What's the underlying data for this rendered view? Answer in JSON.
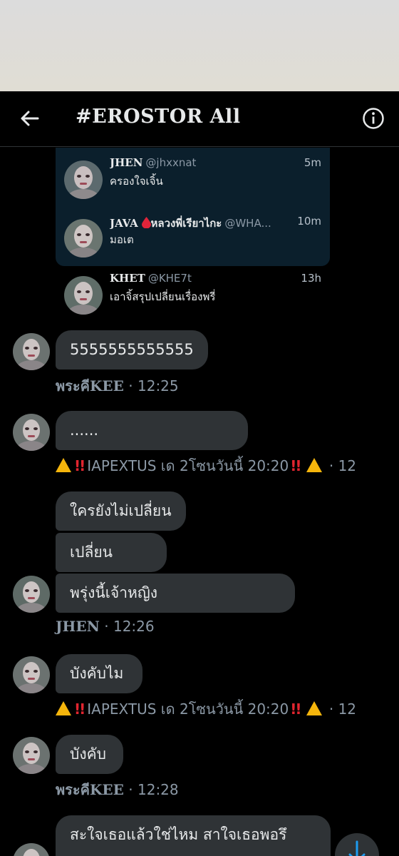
{
  "header": {
    "title": "#EROSTOR All",
    "back_icon": "back-arrow-icon",
    "info_icon": "info-icon"
  },
  "shared_tweets": [
    {
      "name": "JHEN",
      "handle": "@jhxxnat",
      "time": "5m",
      "text": "ครองใจเจิ้น"
    },
    {
      "name": "JAVA",
      "name_extra": "หลวงพี่เรียาไกะ",
      "handle": "@WHA...",
      "time": "10m",
      "text": "มอเต"
    },
    {
      "name": "KHET",
      "handle": "@KHE7t",
      "time": "13h",
      "text": "เอาจิ้สรุปเปลี่ยนเรื่องพรี่"
    }
  ],
  "messages": {
    "m1": "5555555555555",
    "meta1_name": "พระคีKEE",
    "meta1_time": " · 12:25",
    "m2": "......",
    "warn1_text": "IAPEXTUS เด 2โซนวันนี้ 20:20",
    "warn_sep": " · 12",
    "m3": "ใครยังไม่เปลี่ยน",
    "m4": "เปลี่ยน",
    "m5": "พรุ่งนี้เจ้าหญิง",
    "meta2_name": "JHEN",
    "meta2_time": " · 12:26",
    "m6": "บังคับไม",
    "warn2_text": "IAPEXTUS เด 2โซนวันนี้ 20:20",
    "m7": "บังคับ",
    "meta3_name": "พระคีKEE",
    "meta3_time": " · 12:28",
    "m8": "สะใจเธอแล้วใช่ไหม สาใจเธอพอรึ"
  },
  "colors": {
    "bg": "#000000",
    "bubble": "#2f3336",
    "card": "#0b1f2c",
    "muted": "#8b98a5",
    "warn": "#f5b50c",
    "exclaim": "#e1252f"
  }
}
